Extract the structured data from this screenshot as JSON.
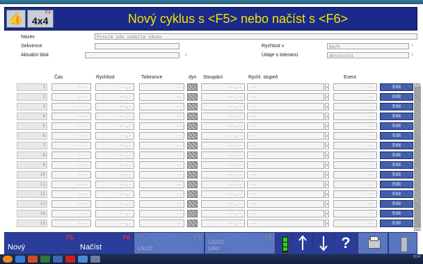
{
  "header": {
    "mode_label": "4x4",
    "mode_key": "F4",
    "title": "Nový cyklus s <F5> nebo načíst s <F6>"
  },
  "form": {
    "nazev_label": "Název",
    "nazev_value": "Prosím zde zadejte název",
    "sekvence_label": "Sekvence",
    "sekvence_value": "",
    "aktualni_blok_label": "Aktuální blok",
    "aktualni_blok_value": "",
    "rychlost_v_label": "Rychlost v",
    "rychlost_v_value": "km/h",
    "udaje_tolerance_label": "Údaje o toleranci",
    "udaje_tolerance_value": "absolutní"
  },
  "table": {
    "headers": {
      "cas": "Čas",
      "rychlost": "Rychlost",
      "tolerance": "Tolerance",
      "dyn": "dyn",
      "stoupani": "Stoupání",
      "rychl_stupen": "Rychl. stupeň",
      "event": "Event"
    },
    "rows": [
      {
        "num": "1",
        "cas": "----",
        "rychlost": "---,-",
        "tolerance": "--",
        "stoupani": "---,--",
        "rychl_stupen": "---",
        "event": "---",
        "edit": "Edit"
      },
      {
        "num": "2",
        "cas": "----",
        "rychlost": "---,-",
        "tolerance": "--",
        "stoupani": "---,--",
        "rychl_stupen": "---",
        "event": "---",
        "edit": "Edit"
      },
      {
        "num": "3",
        "cas": "----",
        "rychlost": "---,-",
        "tolerance": "--",
        "stoupani": "---,--",
        "rychl_stupen": "---",
        "event": "---",
        "edit": "Edit"
      },
      {
        "num": "4",
        "cas": "----",
        "rychlost": "---,-",
        "tolerance": "--",
        "stoupani": "---,--",
        "rychl_stupen": "---",
        "event": "---",
        "edit": "Edit"
      },
      {
        "num": "5",
        "cas": "----",
        "rychlost": "---,-",
        "tolerance": "--",
        "stoupani": "---,--",
        "rychl_stupen": "---",
        "event": "---",
        "edit": "Edit"
      },
      {
        "num": "6",
        "cas": "----",
        "rychlost": "---,-",
        "tolerance": "--",
        "stoupani": "---,--",
        "rychl_stupen": "---",
        "event": "---",
        "edit": "Edit"
      },
      {
        "num": "7",
        "cas": "----",
        "rychlost": "---,-",
        "tolerance": "--",
        "stoupani": "---,--",
        "rychl_stupen": "---",
        "event": "---",
        "edit": "Edit"
      },
      {
        "num": "8",
        "cas": "----",
        "rychlost": "---,-",
        "tolerance": "--",
        "stoupani": "---,--",
        "rychl_stupen": "---",
        "event": "---",
        "edit": "Edit"
      },
      {
        "num": "9",
        "cas": "----",
        "rychlost": "---,-",
        "tolerance": "--",
        "stoupani": "---,--",
        "rychl_stupen": "---",
        "event": "---",
        "edit": "Edit"
      },
      {
        "num": "10",
        "cas": "----",
        "rychlost": "---,-",
        "tolerance": "--",
        "stoupani": "---,--",
        "rychl_stupen": "---",
        "event": "---",
        "edit": "Edit"
      },
      {
        "num": "11",
        "cas": "----",
        "rychlost": "---,-",
        "tolerance": "--",
        "stoupani": "---,--",
        "rychl_stupen": "---",
        "event": "---",
        "edit": "Edit"
      },
      {
        "num": "12",
        "cas": "----",
        "rychlost": "---,-",
        "tolerance": "--",
        "stoupani": "---,--",
        "rychl_stupen": "---",
        "event": "---",
        "edit": "Edit"
      },
      {
        "num": "13",
        "cas": "----",
        "rychlost": "---,-",
        "tolerance": "--",
        "stoupani": "---,--",
        "rychl_stupen": "---",
        "event": "---",
        "edit": "Edit"
      },
      {
        "num": "14",
        "cas": "----",
        "rychlost": "---,-",
        "tolerance": "--",
        "stoupani": "---,--",
        "rychl_stupen": "---",
        "event": "---",
        "edit": "Edit"
      },
      {
        "num": "15",
        "cas": "----",
        "rychlost": "---,-",
        "tolerance": "--",
        "stoupani": "---,--",
        "rychl_stupen": "---",
        "event": "---",
        "edit": "Edit"
      }
    ]
  },
  "scrollbar": {
    "top_label": "500",
    "bottom_label": "500"
  },
  "footer": {
    "buttons": [
      {
        "key": "F5",
        "label": "Nový"
      },
      {
        "key": "F6",
        "label": "Načíst"
      },
      {
        "key": "",
        "label": "Uložit"
      },
      {
        "key": "F7",
        "label": ""
      },
      {
        "key": "F8",
        "label": "Uložit jako"
      }
    ],
    "icons": [
      "battery-icon",
      "arrow-up-icon",
      "arrow-down-icon",
      "help-icon",
      "print-icon",
      "exit-icon"
    ]
  },
  "taskbar": {
    "time": "9:14"
  },
  "colors": {
    "header_bg": "#1a2a8a",
    "title_text": "#f4e300",
    "fkey_red": "#e03030"
  }
}
